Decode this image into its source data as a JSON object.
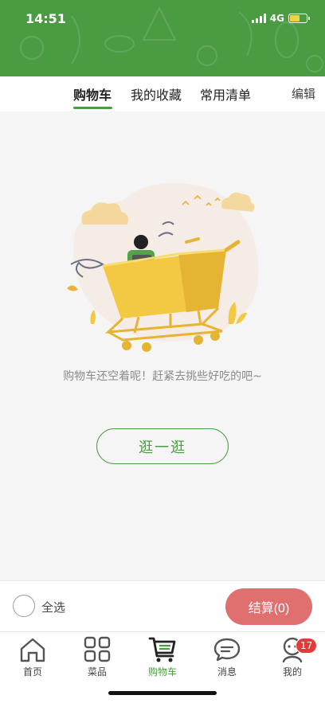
{
  "status_bar": {
    "time": "14:51",
    "network": "4G"
  },
  "tabs": [
    {
      "label": "购物车",
      "active": true
    },
    {
      "label": "我的收藏",
      "active": false
    },
    {
      "label": "常用清单",
      "active": false
    }
  ],
  "edit_label": "编辑",
  "empty": {
    "message": "购物车还空着呢！赶紧去挑些好吃的吧~",
    "browse_button": "逛一逛"
  },
  "checkout": {
    "select_all_label": "全选",
    "pay_button": "结算(0)"
  },
  "bottom_nav": [
    {
      "label": "首页",
      "icon": "home-icon",
      "active": false
    },
    {
      "label": "菜品",
      "icon": "grid-icon",
      "active": false
    },
    {
      "label": "购物车",
      "icon": "cart-icon",
      "active": true
    },
    {
      "label": "消息",
      "icon": "message-icon",
      "active": false
    },
    {
      "label": "我的",
      "icon": "profile-icon",
      "active": false,
      "badge": "17"
    }
  ],
  "colors": {
    "brand_green": "#4a9b42",
    "pay_red": "#e07070",
    "badge_red": "#e23b3b"
  }
}
